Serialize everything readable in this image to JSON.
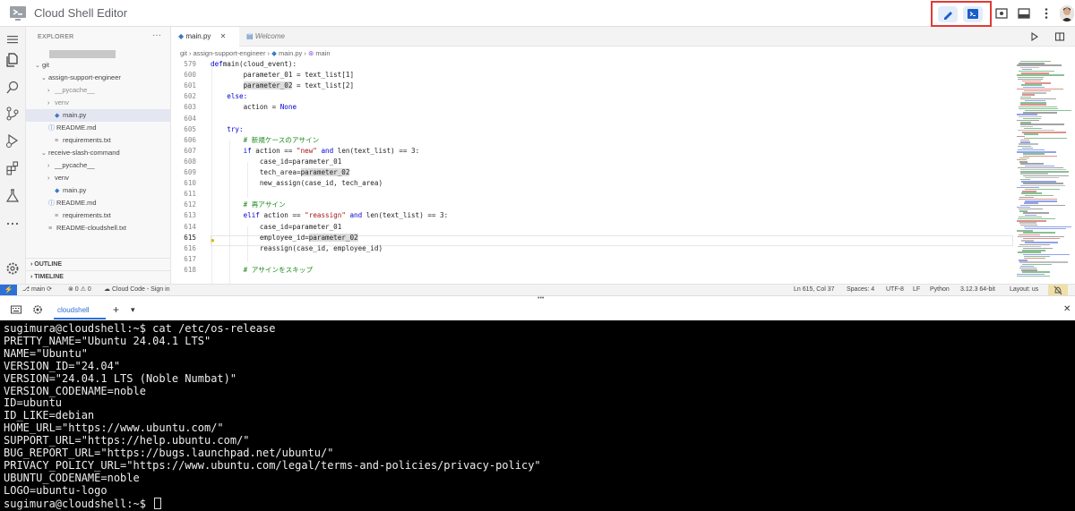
{
  "app": {
    "title": "Cloud Shell Editor"
  },
  "colors": {
    "accent": "#2e6fd8",
    "highlight_border": "#e53935",
    "terminal_bg": "#000000"
  },
  "icons": {
    "topbar": [
      "pencil-icon",
      "terminal-icon",
      "preview-icon",
      "layout-icon",
      "more-vert-icon"
    ],
    "activity": [
      "menu-icon",
      "files-icon",
      "search-icon",
      "source-control-icon",
      "run-debug-icon",
      "extensions-icon",
      "testing-icon",
      "more-icon",
      "settings-icon"
    ]
  },
  "explorer": {
    "title": "EXPLORER",
    "more": "···",
    "tree": [
      {
        "label": "git",
        "chev": "⌄",
        "muted": false
      },
      {
        "label": "assign-support-engineer",
        "chev": "⌄",
        "muted": false
      },
      {
        "label": "__pycache__",
        "chev": "›",
        "muted": true
      },
      {
        "label": "venv",
        "chev": "›",
        "muted": true
      },
      {
        "label": "main.py",
        "chev": "",
        "muted": false
      },
      {
        "label": "README.md",
        "chev": "",
        "muted": false
      },
      {
        "label": "requirements.txt",
        "chev": "",
        "muted": false
      },
      {
        "label": "receive-slash-command",
        "chev": "⌄",
        "muted": false
      },
      {
        "label": "__pycache__",
        "chev": "›",
        "muted": false
      },
      {
        "label": "venv",
        "chev": "›",
        "muted": false
      },
      {
        "label": "main.py",
        "chev": "",
        "muted": false
      },
      {
        "label": "README.md",
        "chev": "",
        "muted": false
      },
      {
        "label": "requirements.txt",
        "chev": "",
        "muted": false
      },
      {
        "label": "README-cloudshell.txt",
        "chev": "",
        "muted": false
      }
    ],
    "sections": {
      "outline": "OUTLINE",
      "timeline": "TIMELINE"
    }
  },
  "tabs": {
    "active": "main.py",
    "inactive": "Welcome"
  },
  "breadcrumb": {
    "path": "git › assign-support-engineer › ",
    "file": "main.py",
    "symbol": "main"
  },
  "editor": {
    "current_line": "615",
    "lines": [
      {
        "n": "579",
        "segs": [
          [
            "kw",
            "def"
          ],
          [
            "",
            "main(cloud_event):"
          ]
        ]
      },
      {
        "n": "600",
        "segs": [
          [
            "",
            "        parameter_01 = text_list[1]"
          ]
        ]
      },
      {
        "n": "601",
        "segs": [
          [
            "",
            "        "
          ],
          [
            "hl",
            "parameter_02"
          ],
          [
            "",
            " = text_list[2]"
          ]
        ]
      },
      {
        "n": "602",
        "segs": [
          [
            "kw",
            "    else:"
          ]
        ]
      },
      {
        "n": "603",
        "segs": [
          [
            "",
            "        action = "
          ],
          [
            "kw",
            "None"
          ]
        ]
      },
      {
        "n": "604",
        "segs": [
          [
            "",
            ""
          ]
        ]
      },
      {
        "n": "605",
        "segs": [
          [
            "kw",
            "    try:"
          ]
        ]
      },
      {
        "n": "606",
        "segs": [
          [
            "cmt",
            "        # 新規ケースのアサイン"
          ]
        ]
      },
      {
        "n": "607",
        "segs": [
          [
            "kw",
            "        if"
          ],
          [
            "",
            " action == "
          ],
          [
            "str",
            "\"new\""
          ],
          [
            "kw",
            " and"
          ],
          [
            "",
            " len(text_list) == 3:"
          ]
        ]
      },
      {
        "n": "608",
        "segs": [
          [
            "",
            "            case_id=parameter_01"
          ]
        ]
      },
      {
        "n": "609",
        "segs": [
          [
            "",
            "            tech_area="
          ],
          [
            "hl",
            "parameter_02"
          ]
        ]
      },
      {
        "n": "610",
        "segs": [
          [
            "",
            "            new_assign(case_id, tech_area)"
          ]
        ]
      },
      {
        "n": "611",
        "segs": [
          [
            "",
            ""
          ]
        ]
      },
      {
        "n": "612",
        "segs": [
          [
            "cmt",
            "        # 再アサイン"
          ]
        ]
      },
      {
        "n": "613",
        "segs": [
          [
            "kw",
            "        elif"
          ],
          [
            "",
            " action == "
          ],
          [
            "str",
            "\"reassign\""
          ],
          [
            "kw",
            " and"
          ],
          [
            "",
            " len(text_list) == 3:"
          ]
        ]
      },
      {
        "n": "614",
        "segs": [
          [
            "",
            "            case_id=parameter_01"
          ]
        ]
      },
      {
        "n": "615",
        "segs": [
          [
            "",
            "            employee_id="
          ],
          [
            "hl",
            "parameter_02"
          ]
        ]
      },
      {
        "n": "616",
        "segs": [
          [
            "",
            "            reassign(case_id, employee_id)"
          ]
        ]
      },
      {
        "n": "617",
        "segs": [
          [
            "",
            ""
          ]
        ]
      },
      {
        "n": "618",
        "segs": [
          [
            "cmt",
            "        # アサインをスキップ"
          ]
        ]
      }
    ]
  },
  "statusbar": {
    "branch": "main",
    "problems": "⊗ 0 ⚠ 0",
    "cloud_code": "Cloud Code - Sign in",
    "position": "Ln 615, Col 37",
    "spaces": "Spaces: 4",
    "encoding": "UTF-8",
    "eol": "LF",
    "language": "Python",
    "interpreter": "3.12.3 64-bit",
    "layout": "Layout: us"
  },
  "panel": {
    "tab": "cloudshell",
    "add": "+",
    "dropdown": "▾",
    "close": "✕",
    "sash": "•••"
  },
  "terminal": {
    "lines": [
      "sugimura@cloudshell:~$ cat /etc/os-release",
      "PRETTY_NAME=\"Ubuntu 24.04.1 LTS\"",
      "NAME=\"Ubuntu\"",
      "VERSION_ID=\"24.04\"",
      "VERSION=\"24.04.1 LTS (Noble Numbat)\"",
      "VERSION_CODENAME=noble",
      "ID=ubuntu",
      "ID_LIKE=debian",
      "HOME_URL=\"https://www.ubuntu.com/\"",
      "SUPPORT_URL=\"https://help.ubuntu.com/\"",
      "BUG_REPORT_URL=\"https://bugs.launchpad.net/ubuntu/\"",
      "PRIVACY_POLICY_URL=\"https://www.ubuntu.com/legal/terms-and-policies/privacy-policy\"",
      "UBUNTU_CODENAME=noble",
      "LOGO=ubuntu-logo"
    ],
    "prompt": "sugimura@cloudshell:~$ "
  }
}
